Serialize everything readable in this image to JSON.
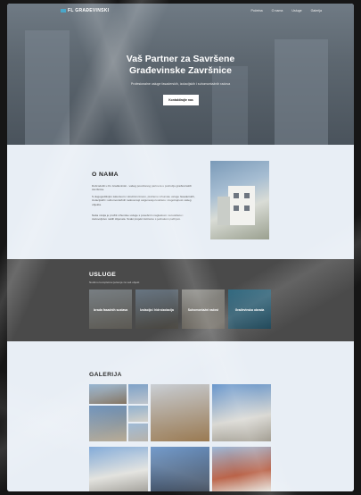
{
  "nav": {
    "logo": "FL GRAĐEVINSKI",
    "links": [
      "Početna",
      "O nama",
      "Usluge",
      "Galerija"
    ]
  },
  "hero": {
    "title_line1": "Vaš Partner za Savršene",
    "title_line2": "Građevinske Završnice",
    "subtitle": "Profesionalne usluge fasaderskih, izolacijskih i suhomontažnih radova",
    "button": "Kontaktirajte nas"
  },
  "about": {
    "heading": "O NAMA",
    "paragraphs": [
      "Dobrodošli u FL Građevinski - vašeg pouzdanog partnera u području građevinskih završnica.",
      "S dugogodišnjim iskustvom i stručnim timom, pružamo vrhunske usluge fasaderskih, izolacijskih i suhomontažnih radova koji osiguravaju kvalitetu i dugotrajnost vašeg objekta.",
      "Naša misija je pružiti vrhunske usluge s posebnim naglaskom na kvalitetu i zadovoljstvo naših klijenata. Svaki projekt tretiramo s jednakom pažnjom."
    ]
  },
  "services": {
    "heading": "USLUGE",
    "subtitle": "Nudimo kompletna rješenja za vaš objekt",
    "cards": [
      {
        "label": "Izrada fasadnih sustava"
      },
      {
        "label": "Izolacija i hidroizolacija"
      },
      {
        "label": "Suhomontažni radovi"
      },
      {
        "label": "Građevinska obrada"
      }
    ]
  },
  "gallery": {
    "heading": "GALERIJA"
  }
}
